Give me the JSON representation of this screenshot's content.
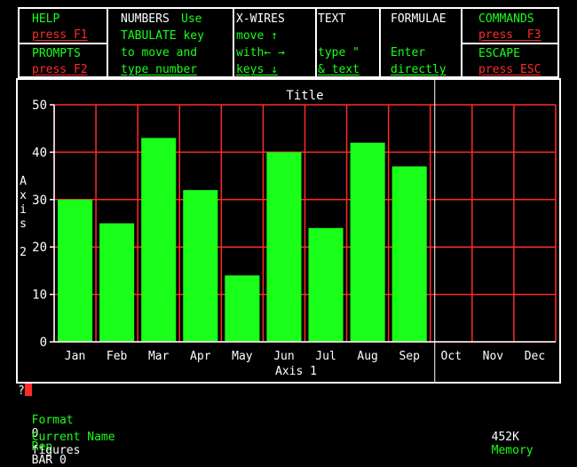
{
  "help_panel": {
    "cols": [
      {
        "head": "HELP",
        "head_color": "green",
        "lines": [
          {
            "text": "press F1",
            "color": "red"
          }
        ],
        "lower_head": "PROMPTS",
        "lower_lines": [
          {
            "text": "press F2",
            "color": "red"
          }
        ]
      },
      {
        "head": "NUMBERS",
        "head_extra": "Use",
        "lines": [
          {
            "text": "TABULATE key",
            "color": "green"
          },
          {
            "text": "to move and",
            "color": "green"
          },
          {
            "text": "type number",
            "color": "green"
          }
        ]
      },
      {
        "head": "X-WIRES",
        "lines": [
          {
            "text": "move ↑",
            "color": "green"
          },
          {
            "text": "with← →",
            "color": "green"
          },
          {
            "text": "keys ↓",
            "color": "green"
          }
        ]
      },
      {
        "head": "TEXT",
        "lines": [
          {
            "text": "type \"",
            "color": "green"
          },
          {
            "text": "& text",
            "color": "green"
          }
        ]
      },
      {
        "head": "FORMULAE",
        "lines": [
          {
            "text": "Enter",
            "color": "green"
          },
          {
            "text": "directly",
            "color": "green"
          }
        ]
      },
      {
        "head": "COMMANDS",
        "lines": [
          {
            "text": "press  F3",
            "color": "red"
          }
        ],
        "lower_head": "ESCAPE",
        "lower_lines": [
          {
            "text": "press ESC",
            "color": "red"
          }
        ]
      }
    ]
  },
  "chart_data": {
    "type": "bar",
    "title": "Title",
    "xlabel": "Axis 1",
    "ylabel": "Axis 2",
    "categories": [
      "Jan",
      "Feb",
      "Mar",
      "Apr",
      "May",
      "Jun",
      "Jul",
      "Aug",
      "Sep",
      "Oct",
      "Nov",
      "Dec"
    ],
    "values": [
      30,
      25,
      43,
      32,
      14,
      40,
      24,
      42,
      37,
      null,
      null,
      null
    ],
    "ylim": [
      0,
      50
    ],
    "yticks": [
      0,
      10,
      20,
      30,
      40,
      50
    ],
    "grid": true,
    "bar_color": "#19ff19",
    "grid_color": "#ff2a2a",
    "crosswire_category": "Oct"
  },
  "prompt": {
    "symbol": "?",
    "format_label": "Format",
    "format_value": "0",
    "rep_label": "Rep",
    "rep_value": "BAR 0",
    "current_name_label": "Current Name",
    "current_name_value": "figures",
    "memory_value": "452K",
    "memory_label": "Memory"
  }
}
